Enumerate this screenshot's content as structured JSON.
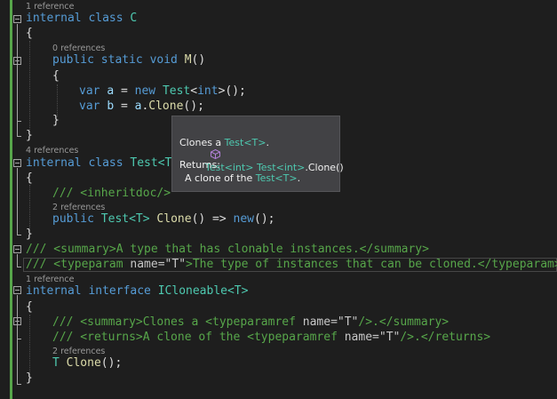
{
  "lens": {
    "class_c_refs": "1 reference",
    "method_m_refs": "0 references",
    "class_test_refs": "4 references",
    "clone_impl_refs": "2 references",
    "interface_refs": "1 reference",
    "interface_clone_refs": "2 references"
  },
  "code": {
    "l1_kw": "internal class",
    "l1_name": "C",
    "open_brace": "{",
    "close_brace": "}",
    "m_kw": "public static void",
    "m_name": "M",
    "m_parens": "()",
    "var_kw": "var",
    "a_name": "a",
    "assign": " = ",
    "new_kw": "new",
    "test_ty": "Test",
    "lt": "<",
    "int_kw": "int",
    "gt_call": ">();",
    "b_name": "b",
    "a_ref": "a",
    "clone_call_dot": ".",
    "clone_call_name": "Clone",
    "clone_call_end": "();",
    "test_class_kw": "internal class",
    "test_class_name": "Test<T>",
    "inheritdoc": "/// <inheritdoc/>",
    "pub_kw": "public",
    "test_t": "Test<T>",
    "clone_name": "Clone",
    "arrow": "() => ",
    "new_kw2": "new",
    "new_end": "();",
    "summary_line": "/// <summary>A type that has clonable instances.</summary>",
    "typeparam_pre": "/// <typeparam ",
    "typeparam_attr": "name=",
    "typeparam_val": "\"T\"",
    "typeparam_post": ">The type of instances that can be cloned.</typeparam>",
    "iface_kw": "internal interface",
    "iface_name": "ICloneable<T>",
    "iface_summary_pre": "/// <summary>Clones a <typeparamref ",
    "iface_summary_attr": "name=",
    "iface_summary_val": "\"T\"",
    "iface_summary_post": "/>.</summary>",
    "iface_returns_pre": "/// <returns>A clone of the <typeparamref ",
    "iface_returns_attr": "name=",
    "iface_returns_val": "\"T\"",
    "iface_returns_post": "/>.</returns>",
    "iface_method_t": "T",
    "iface_method_name": "Clone",
    "iface_method_end": "();"
  },
  "tooltip": {
    "sig_ret": "Test<int>",
    "sig_owner": "Test<int>",
    "sig_method": ".Clone()",
    "desc_pre": "Clones a ",
    "desc_ty": "Test<T>",
    "desc_post": ".",
    "returns_label": "Returns:",
    "returns_pre": "A clone of the ",
    "returns_ty": "Test<T>",
    "returns_post": ".",
    "icon": "method-cube-icon"
  },
  "colors": {
    "background": "#1e1e1e",
    "keyword": "#569cd6",
    "type": "#4ec9b0",
    "method": "#dcdcaa",
    "comment": "#57a64a",
    "tooltip_bg": "#424245"
  }
}
